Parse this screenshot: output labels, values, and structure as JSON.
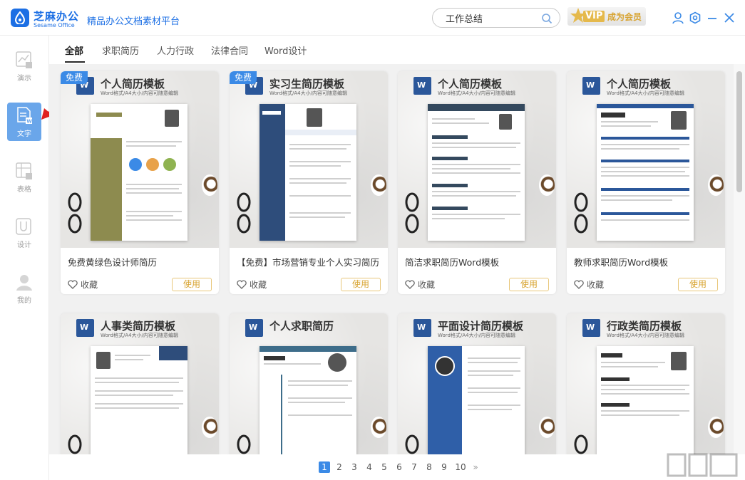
{
  "app": {
    "name_cn": "芝麻办公",
    "name_en": "Sesame Office",
    "slogan": "精品办公文档素材平台"
  },
  "search": {
    "value": "工作总结",
    "placeholder": ""
  },
  "vip": {
    "badge": "VIP",
    "label": "成为会员"
  },
  "sidebar": {
    "items": [
      {
        "label": "演示",
        "icon": "presentation-icon"
      },
      {
        "label": "文字",
        "icon": "word-document-icon"
      },
      {
        "label": "表格",
        "icon": "spreadsheet-icon"
      },
      {
        "label": "设计",
        "icon": "design-icon"
      },
      {
        "label": "我的",
        "icon": "user-icon"
      }
    ]
  },
  "tabs": [
    "全部",
    "求职简历",
    "人力行政",
    "法律合同",
    "Word设计"
  ],
  "card_common": {
    "fav_label": "收藏",
    "use_label": "使用",
    "free_badge": "免费",
    "subtitle": "Word格式/A4大小/内容可随意编辑"
  },
  "cards": [
    {
      "heading": "个人简历模板",
      "title": "免费黄绿色设计师简历",
      "free": true,
      "accent": "#8d8b4f"
    },
    {
      "heading": "实习生简历模板",
      "title": "【免费】市场营销专业个人实习简历",
      "free": true,
      "accent": "#2e4d7b"
    },
    {
      "heading": "个人简历模板",
      "title": "简洁求职简历Word模板",
      "free": false,
      "accent": "#34495e"
    },
    {
      "heading": "个人简历模板",
      "title": "教师求职简历Word模板",
      "free": false,
      "accent": "#2b579a"
    },
    {
      "heading": "人事类简历模板",
      "title": "",
      "free": false,
      "accent": "#2e4d7b"
    },
    {
      "heading": "个人求职简历",
      "title": "",
      "free": false,
      "accent": "#3e6d8a"
    },
    {
      "heading": "平面设计简历模板",
      "title": "",
      "free": false,
      "accent": "#2f5fa8"
    },
    {
      "heading": "行政类简历模板",
      "title": "",
      "free": false,
      "accent": "#333333"
    }
  ],
  "pagination": {
    "pages": [
      "1",
      "2",
      "3",
      "4",
      "5",
      "6",
      "7",
      "8",
      "9",
      "10"
    ],
    "current": "1",
    "next": "»"
  }
}
